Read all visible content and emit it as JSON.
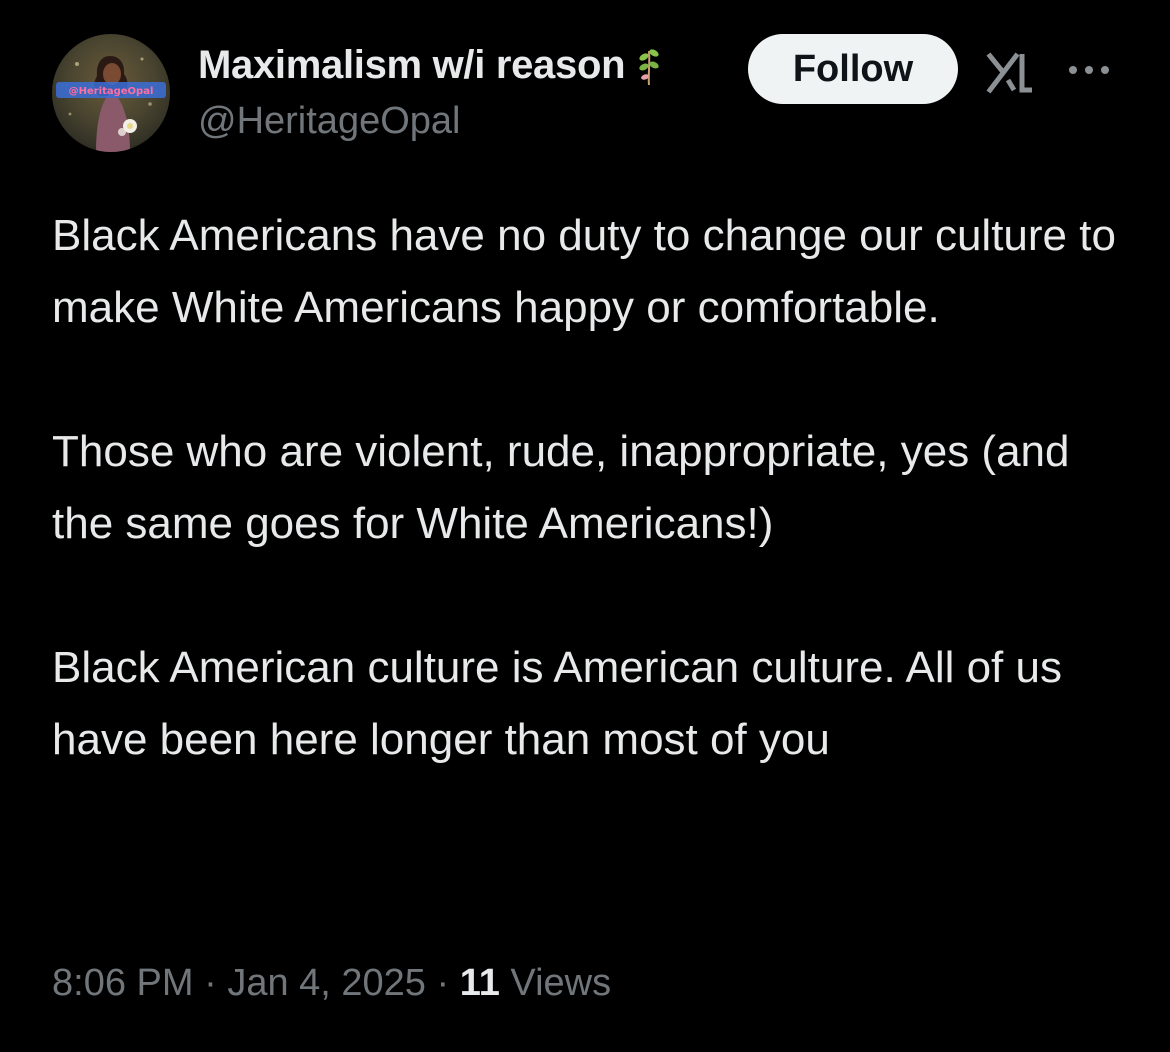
{
  "author": {
    "display_name": "Maximalism w/i reason",
    "handle": "@HeritageOpal",
    "avatar_label": "@HeritageOpal",
    "name_icon": "sprout-icon"
  },
  "actions": {
    "follow_label": "Follow",
    "grok_icon": "grok-icon",
    "more_icon": "more-icon"
  },
  "tweet": {
    "paragraphs": [
      "Black Americans have no duty to change our culture to make White Americans happy or comfortable.",
      "Those who are violent, rude, inappropriate, yes (and the same goes for White Americans!)",
      "Black American culture is American culture. All of us have been here longer than most of you"
    ]
  },
  "meta": {
    "time": "8:06 PM",
    "separator": " · ",
    "date": "Jan 4, 2025",
    "views_count": "11",
    "views_label": " Views"
  },
  "colors": {
    "background": "#000000",
    "text_primary": "#e7e9ea",
    "text_secondary": "#71767b",
    "follow_bg": "#eff3f4",
    "follow_text": "#0f1419",
    "sprout_green": "#8bc34a",
    "sprout_pink": "#e6a1a8"
  }
}
